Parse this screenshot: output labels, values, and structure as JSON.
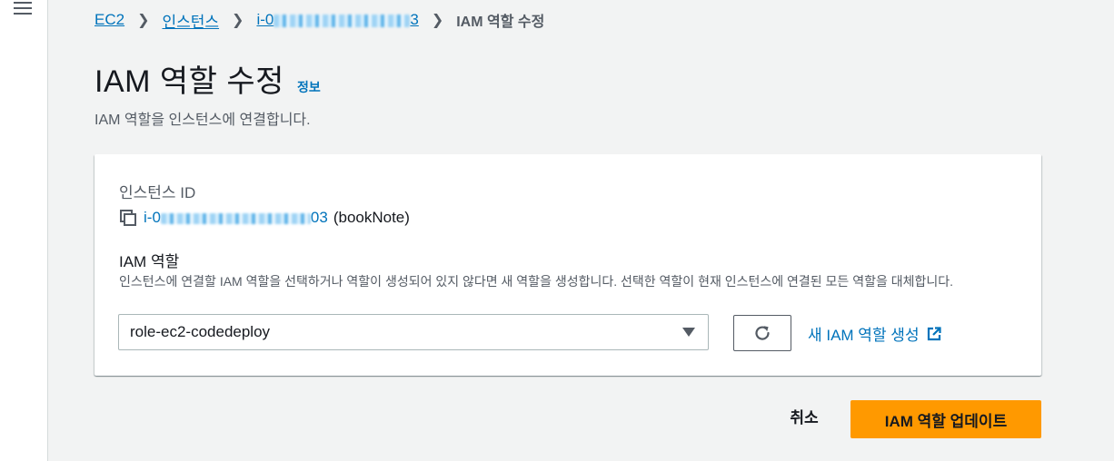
{
  "breadcrumb": {
    "ec2": "EC2",
    "instances": "인스턴스",
    "instance_prefix": "i-0",
    "instance_suffix": "3",
    "current": "IAM 역할 수정"
  },
  "page": {
    "title": "IAM 역할 수정",
    "info": "정보",
    "description": "IAM 역할을 인스턴스에 연결합니다."
  },
  "instance": {
    "label": "인스턴스 ID",
    "id_prefix": "i-0",
    "id_suffix": "03",
    "name": "(bookNote)"
  },
  "role": {
    "label": "IAM 역할",
    "description": "인스턴스에 연결할 IAM 역할을 선택하거나 역할이 생성되어 있지 않다면 새 역할을 생성합니다. 선택한 역할이 현재 인스턴스에 연결된 모든 역할을 대체합니다.",
    "selected": "role-ec2-codedeploy",
    "create_link": "새 IAM 역할 생성"
  },
  "actions": {
    "cancel": "취소",
    "update": "IAM 역할 업데이트"
  },
  "colors": {
    "link": "#0073bb",
    "primary": "#ff9900",
    "background": "#f2f3f3"
  },
  "icons": [
    "menu-icon",
    "chevron-right-icon",
    "copy-icon",
    "caret-down-icon",
    "refresh-icon",
    "external-link-icon"
  ]
}
